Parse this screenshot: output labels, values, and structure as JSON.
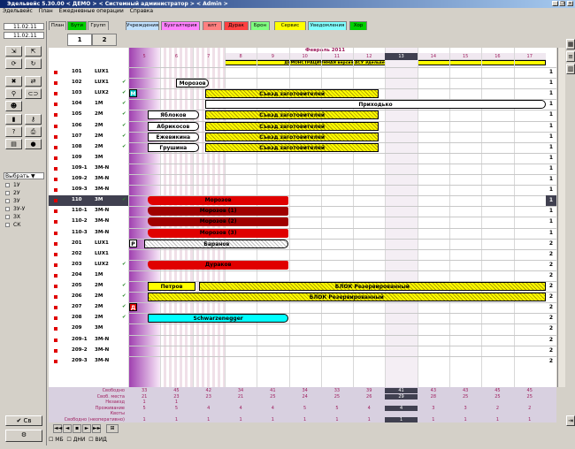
{
  "window": {
    "title": "Эдельвейс 5.30.00 < ДЕМО > < Системный администратор > < Admin >",
    "controls": [
      "_",
      "❐",
      "×"
    ]
  },
  "menu": [
    "Эдельвейс",
    "План",
    "Ежедневные операции",
    "Справка"
  ],
  "left": {
    "date1": "11.02.11",
    "date2": "11.02.11",
    "select_label": "Выбрать",
    "filters": [
      "1У",
      "2У",
      "3У",
      "3У-У",
      "ЗХ",
      "СК"
    ],
    "bottom_label": "Св"
  },
  "tabs": [
    {
      "label": "План",
      "color": "#ffffff"
    },
    {
      "label": "Бути",
      "color": "#00d000"
    },
    {
      "label": "Групп",
      "color": "#ffffff"
    },
    {
      "label": "Учреждения",
      "color": "#c0e0ff"
    },
    {
      "label": "Бухгалтерия",
      "color": "#ff80ff"
    },
    {
      "label": "влт",
      "color": "#ff8080"
    },
    {
      "label": "Дурак",
      "color": "#ff4040"
    },
    {
      "label": "Брон",
      "color": "#80ff80"
    },
    {
      "label": "Сервис",
      "color": "#ffff00"
    },
    {
      "label": "Уведомления",
      "color": "#80ffff"
    },
    {
      "label": "Хор",
      "color": "#00d000"
    }
  ],
  "pages": [
    "1",
    "2"
  ],
  "calendar": {
    "month_label": "Февраль 2011",
    "days": [
      "5",
      "6",
      "7",
      "8",
      "9",
      "10",
      "11",
      "12",
      "13",
      "14",
      "15",
      "16",
      "17"
    ],
    "demo_banner": "ДЕМОНСТРАЦИОННАЯ версия АСУ Эдельвейс"
  },
  "rooms": [
    {
      "num": "101",
      "type": "LUX1",
      "check": false,
      "right": "1"
    },
    {
      "num": "102",
      "type": "LUX1",
      "check": true,
      "right": "1"
    },
    {
      "num": "103",
      "type": "LUX2",
      "check": true,
      "right": "1"
    },
    {
      "num": "104",
      "type": "1М",
      "check": true,
      "right": "1"
    },
    {
      "num": "105",
      "type": "2М",
      "check": true,
      "right": "1"
    },
    {
      "num": "106",
      "type": "2М",
      "check": true,
      "right": "1"
    },
    {
      "num": "107",
      "type": "2М",
      "check": true,
      "right": "1"
    },
    {
      "num": "108",
      "type": "2М",
      "check": true,
      "right": "1"
    },
    {
      "num": "109",
      "type": "3М",
      "check": false,
      "right": "1"
    },
    {
      "num": "109-1",
      "type": "3М-N",
      "check": false,
      "right": "1"
    },
    {
      "num": "109-2",
      "type": "3М-N",
      "check": false,
      "right": "1"
    },
    {
      "num": "109-3",
      "type": "3М-N",
      "check": false,
      "right": "1"
    },
    {
      "num": "110",
      "type": "3М",
      "check": true,
      "right": "1"
    },
    {
      "num": "110-1",
      "type": "3М-N",
      "check": false,
      "right": "1"
    },
    {
      "num": "110-2",
      "type": "3М-N",
      "check": false,
      "right": "1"
    },
    {
      "num": "110-3",
      "type": "3М-N",
      "check": false,
      "right": "1"
    },
    {
      "num": "201",
      "type": "LUX1",
      "check": false,
      "right": "2"
    },
    {
      "num": "202",
      "type": "LUX1",
      "check": false,
      "right": "2"
    },
    {
      "num": "203",
      "type": "LUX2",
      "check": true,
      "right": "2"
    },
    {
      "num": "204",
      "type": "1М",
      "check": false,
      "right": "2"
    },
    {
      "num": "205",
      "type": "2М",
      "check": true,
      "right": "2"
    },
    {
      "num": "206",
      "type": "2М",
      "check": true,
      "right": "2"
    },
    {
      "num": "207",
      "type": "2М",
      "check": true,
      "right": "2"
    },
    {
      "num": "208",
      "type": "2М",
      "check": true,
      "right": "2"
    },
    {
      "num": "209",
      "type": "3М",
      "check": false,
      "right": "2"
    },
    {
      "num": "209-1",
      "type": "3М-N",
      "check": false,
      "right": "2"
    },
    {
      "num": "209-2",
      "type": "3М-N",
      "check": false,
      "right": "2"
    },
    {
      "num": "209-3",
      "type": "3М-N",
      "check": false,
      "right": "2"
    }
  ],
  "bookings": {
    "morozov_102": "Морозов",
    "sezd_103": "Съезд заготовителей",
    "badge_103": "М",
    "prikhodko_104": "Приходько",
    "yablokov": "Яблоков",
    "sezd_105": "Съезд заготовителей",
    "abrikosov": "Абрикосов",
    "sezd_106": "Съезд заготовителей",
    "ezhevikina": "Ежевикина",
    "sezd_107": "Съезд заготовителей",
    "grushina": "Грушина",
    "sezd_108": "Съезд заготовителей",
    "morozov_110": "Морозов",
    "morozov_110_1": "Морозов (1)",
    "morozov_110_2": "Морозов (2)",
    "morozov_110_3": "Морозов (3)",
    "badge_201": "Р",
    "baranov": "Баранов",
    "durakov": "Дураков",
    "petrov": "Петров",
    "block_205": "БЛОК Резервированный",
    "block_206": "БЛОК Резервированный",
    "badge_207": "Д",
    "schwarzenegger": "Schwarzenegger"
  },
  "stats": {
    "labels": [
      "Свободно",
      "Своб. места",
      "Незаезд",
      "Проживание",
      "Квоты",
      "Свободно (неоперативно)"
    ],
    "rows": [
      [
        "33",
        "45",
        "42",
        "34",
        "41",
        "34",
        "33",
        "39",
        "41",
        "43",
        "43",
        "45",
        "45"
      ],
      [
        "21",
        "23",
        "23",
        "21",
        "25",
        "24",
        "25",
        "26",
        "29",
        "28",
        "25",
        "25",
        "25"
      ],
      [
        "1",
        "1",
        "",
        "",
        "",
        "",
        "",
        "",
        "",
        "",
        "",
        "",
        ""
      ],
      [
        "5",
        "5",
        "4",
        "4",
        "4",
        "5",
        "5",
        "4",
        "4",
        "3",
        "3",
        "2",
        "2"
      ],
      [
        "",
        "",
        "",
        "",
        "",
        "",
        "",
        "",
        "",
        "",
        "",
        "",
        ""
      ],
      [
        "1",
        "1",
        "1",
        "1",
        "1",
        "1",
        "1",
        "1",
        "1",
        "1",
        "1",
        "1",
        "1"
      ]
    ]
  },
  "nav": [
    "◄◄",
    "◄",
    "▪",
    "►",
    "►►"
  ],
  "status": [
    "МБ",
    "ДНИ",
    "ВИД"
  ]
}
